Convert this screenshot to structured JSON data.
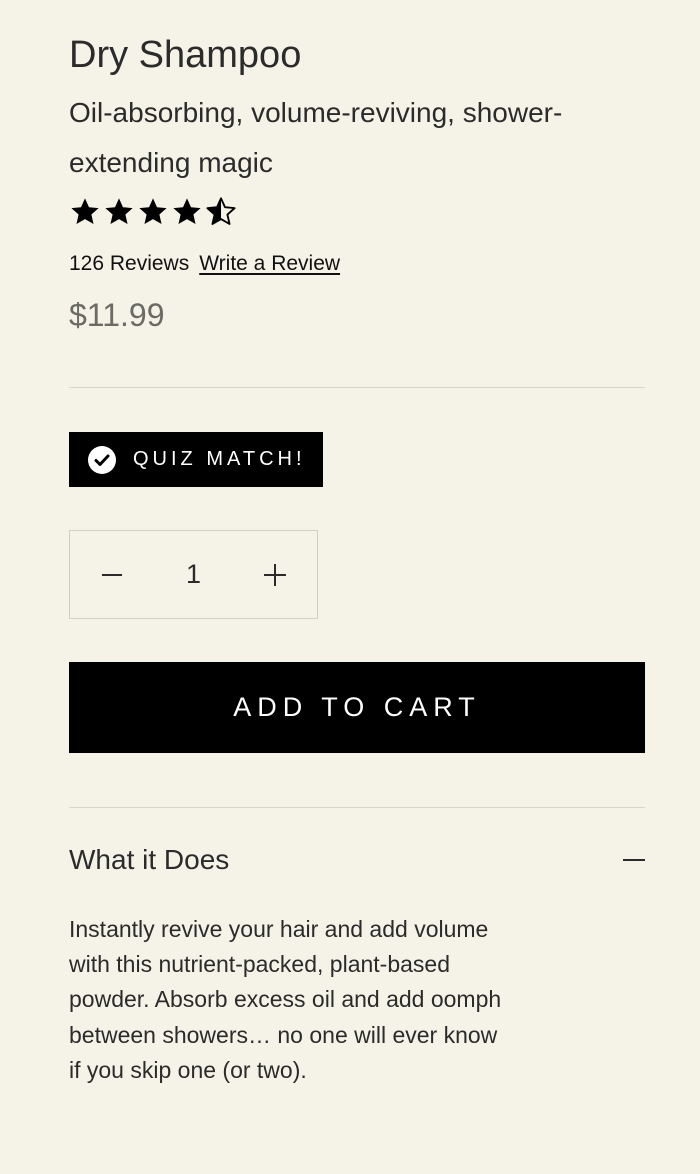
{
  "product": {
    "title": "Dry Shampoo",
    "subtitle": "Oil-absorbing, volume-reviving, shower-extending magic",
    "rating": 4.5,
    "rating_max": 5,
    "review_count_text": "126 Reviews",
    "write_review_label": "Write a Review",
    "price": "$11.99"
  },
  "badge": {
    "label": "QUIZ MATCH!",
    "icon": "check-circle-icon"
  },
  "quantity": {
    "value": "1",
    "decrement_icon": "minus-icon",
    "increment_icon": "plus-icon"
  },
  "cart": {
    "add_label": "ADD TO CART"
  },
  "accordion": {
    "title": "What it Does",
    "toggle_icon": "minus-icon",
    "expanded": true,
    "body": "Instantly revive your hair and add volume with this nutrient-packed, plant-based powder. Absorb excess oil and add oomph between showers… no one will ever know if you skip one (or two)."
  },
  "colors": {
    "background": "#f5f3e7",
    "text": "#2b2b2b",
    "price": "#6b6b66",
    "button": "#000000",
    "divider": "#d8d5c8"
  }
}
